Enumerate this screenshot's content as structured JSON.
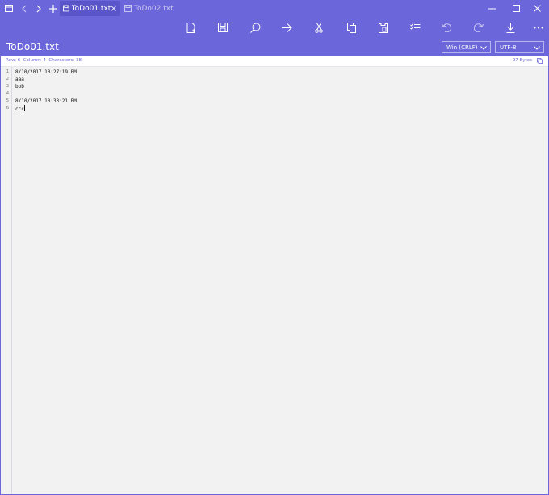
{
  "tabs": [
    {
      "label": "ToDo01.txt",
      "active": true
    },
    {
      "label": "ToDo02.txt",
      "active": false
    }
  ],
  "file": {
    "name": "ToDo01.txt",
    "line_ending": "Win (CRLF)",
    "encoding": "UTF-8"
  },
  "status": {
    "row": "Row: 6",
    "column": "Column: 4",
    "characters": "Characters: 38",
    "bytes": "97 Bytes"
  },
  "editor": {
    "line_numbers": [
      "1",
      "2",
      "3",
      "4",
      "5",
      "6"
    ],
    "lines": [
      "8/10/2017 10:27:19 PM",
      "aaa",
      "bbb",
      "",
      "8/10/2017 10:33:21 PM",
      "ccc"
    ]
  },
  "toolbar": {
    "icons": [
      "new-file-icon",
      "save-icon",
      "search-icon",
      "go-to-icon",
      "cut-icon",
      "copy-icon",
      "paste-icon",
      "select-all-icon",
      "undo-icon",
      "redo-icon",
      "save-as-icon",
      "more-icon"
    ]
  },
  "colors": {
    "accent": "#6b66d9",
    "tab_active": "#5a55c8",
    "editor_bg": "#f3f2f2"
  }
}
